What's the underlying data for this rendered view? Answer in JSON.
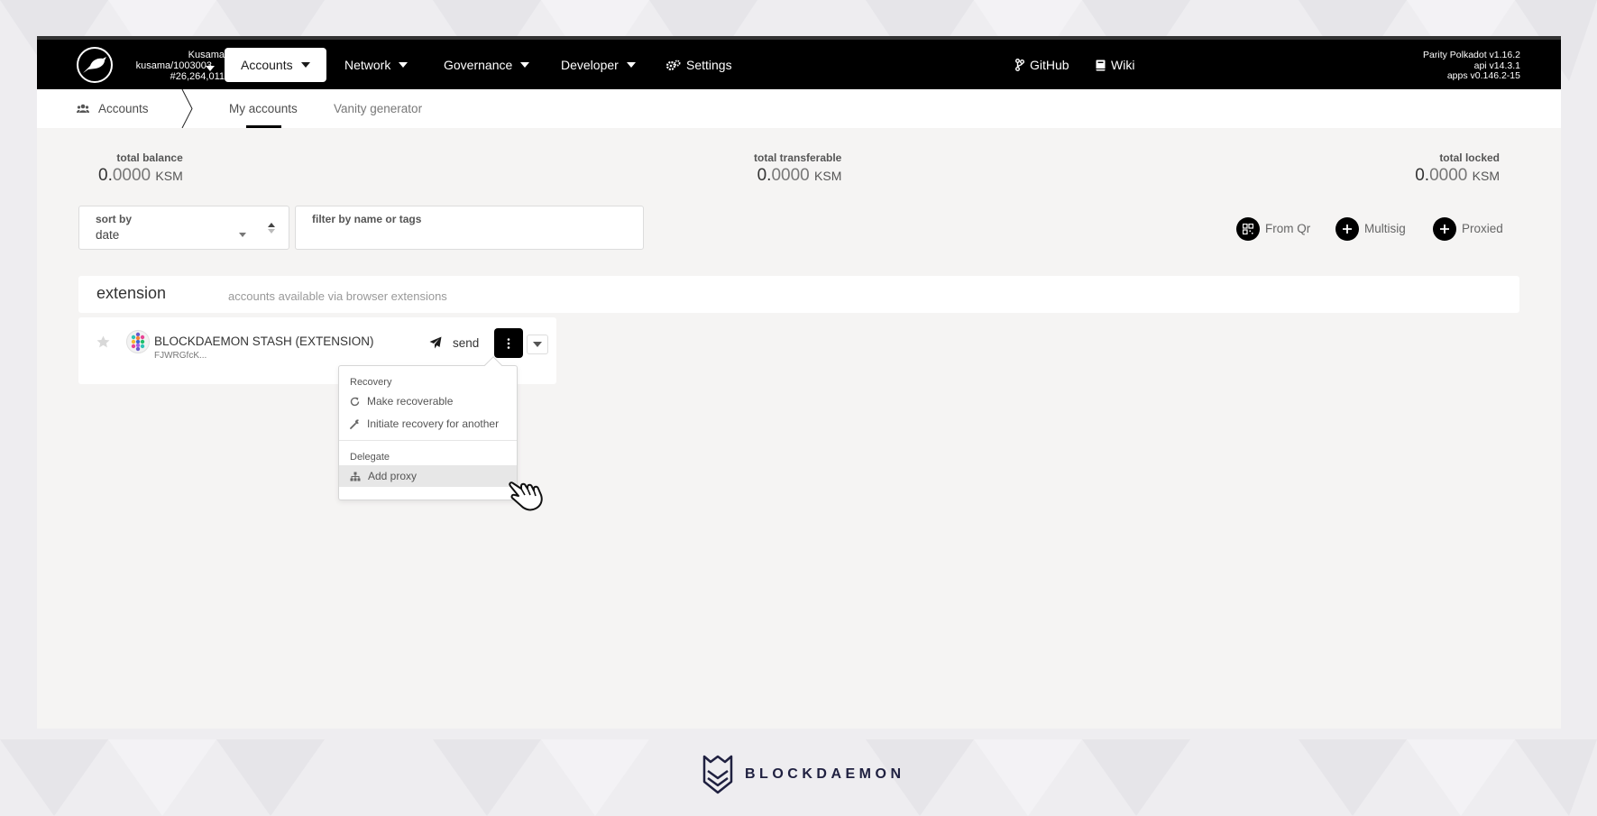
{
  "chain": {
    "name": "Kusama",
    "node": "kusama/1003003",
    "block": "#26,264,011"
  },
  "nav": {
    "accounts": "Accounts",
    "network": "Network",
    "governance": "Governance",
    "developer": "Developer",
    "settings": "Settings",
    "github": "GitHub",
    "wiki": "Wiki"
  },
  "version": {
    "client": "Parity Polkadot v1.16.2",
    "api": "api v14.3.1",
    "apps": "apps v0.146.2-15"
  },
  "subnav": {
    "section": "Accounts",
    "tabs": [
      "My accounts",
      "Vanity generator"
    ]
  },
  "balances": {
    "total_balance": {
      "label": "total balance",
      "int": "0.",
      "dec": "0000",
      "unit": "KSM"
    },
    "total_transferable": {
      "label": "total transferable",
      "int": "0.",
      "dec": "0000",
      "unit": "KSM"
    },
    "total_locked": {
      "label": "total locked",
      "int": "0.",
      "dec": "0000",
      "unit": "KSM"
    }
  },
  "controls": {
    "sort_label": "sort by",
    "sort_value": "date",
    "filter_label": "filter by name or tags"
  },
  "actions": {
    "from_qr": "From Qr",
    "multisig": "Multisig",
    "proxied": "Proxied"
  },
  "extension": {
    "title": "extension",
    "subtitle": "accounts available via browser extensions"
  },
  "account": {
    "name": "BLOCKDAEMON STASH (EXTENSION)",
    "address": "FJWRGfcK...",
    "send_label": "send"
  },
  "menu": {
    "recovery_header": "Recovery",
    "make_recoverable": "Make recoverable",
    "initiate_recovery": "Initiate recovery for another",
    "delegate_header": "Delegate",
    "add_proxy": "Add proxy"
  },
  "footer": {
    "brand": "BLOCKDAEMON"
  }
}
